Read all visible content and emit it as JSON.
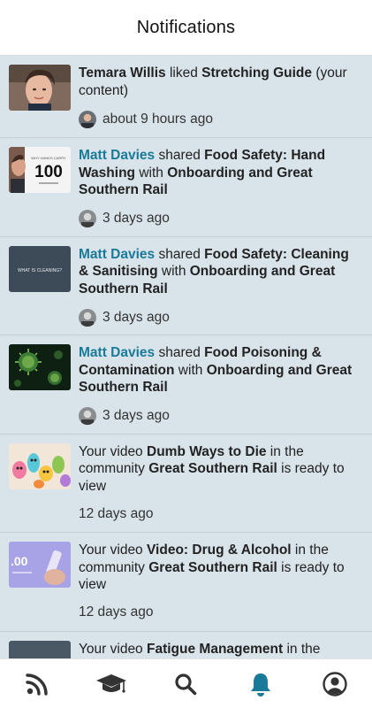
{
  "header": {
    "title": "Notifications"
  },
  "notifications": [
    {
      "p0": "Temara Willis",
      "p1": " liked ",
      "p2": "Stretching Guide",
      "p3": " (your content)",
      "time": "about 9 hours ago"
    },
    {
      "p0": "Matt Davies",
      "p1": " shared ",
      "p2": "Food Safety: Hand Washing",
      "p3": " with ",
      "p4": "Onboarding and Great Southern Rail",
      "time": "3 days ago"
    },
    {
      "p0": "Matt Davies",
      "p1": " shared ",
      "p2": "Food Safety: Cleaning & Sanitising ",
      "p3": " with ",
      "p4": "Onboarding and Great Southern Rail",
      "time": "3 days ago"
    },
    {
      "p0": "Matt Davies",
      "p1": " shared ",
      "p2": "Food Poisoning & Contamination",
      "p3": " with ",
      "p4": "Onboarding and Great Southern Rail",
      "time": "3 days ago"
    },
    {
      "p0": "Your video ",
      "p1": "Dumb Ways to Die",
      "p2": " in the community ",
      "p3": "Great Southern Rail",
      "p4": " is ready to view",
      "time": "12 days ago"
    },
    {
      "p0": "Your video ",
      "p1": "Video: Drug & Alcohol ",
      "p2": " in the community ",
      "p3": "Great Southern Rail",
      "p4": " is ready to view",
      "time": "12 days ago"
    },
    {
      "p0": "Your video ",
      "p1": "Fatigue Management",
      "p2": " in the"
    }
  ],
  "thumbs": {
    "t2_big": "100",
    "t2_small": "WHY HANDS CARRY",
    "t3_text": "WHAT IS CLEANING?",
    "t6_text": ".00"
  },
  "tabs": {
    "feed": "rss-icon",
    "learn": "graduation-cap-icon",
    "search": "search-icon",
    "notifications": "bell-icon",
    "profile": "user-circle-icon"
  },
  "colors": {
    "accent": "#1a7a99",
    "list_bg": "#d8e3ea"
  }
}
